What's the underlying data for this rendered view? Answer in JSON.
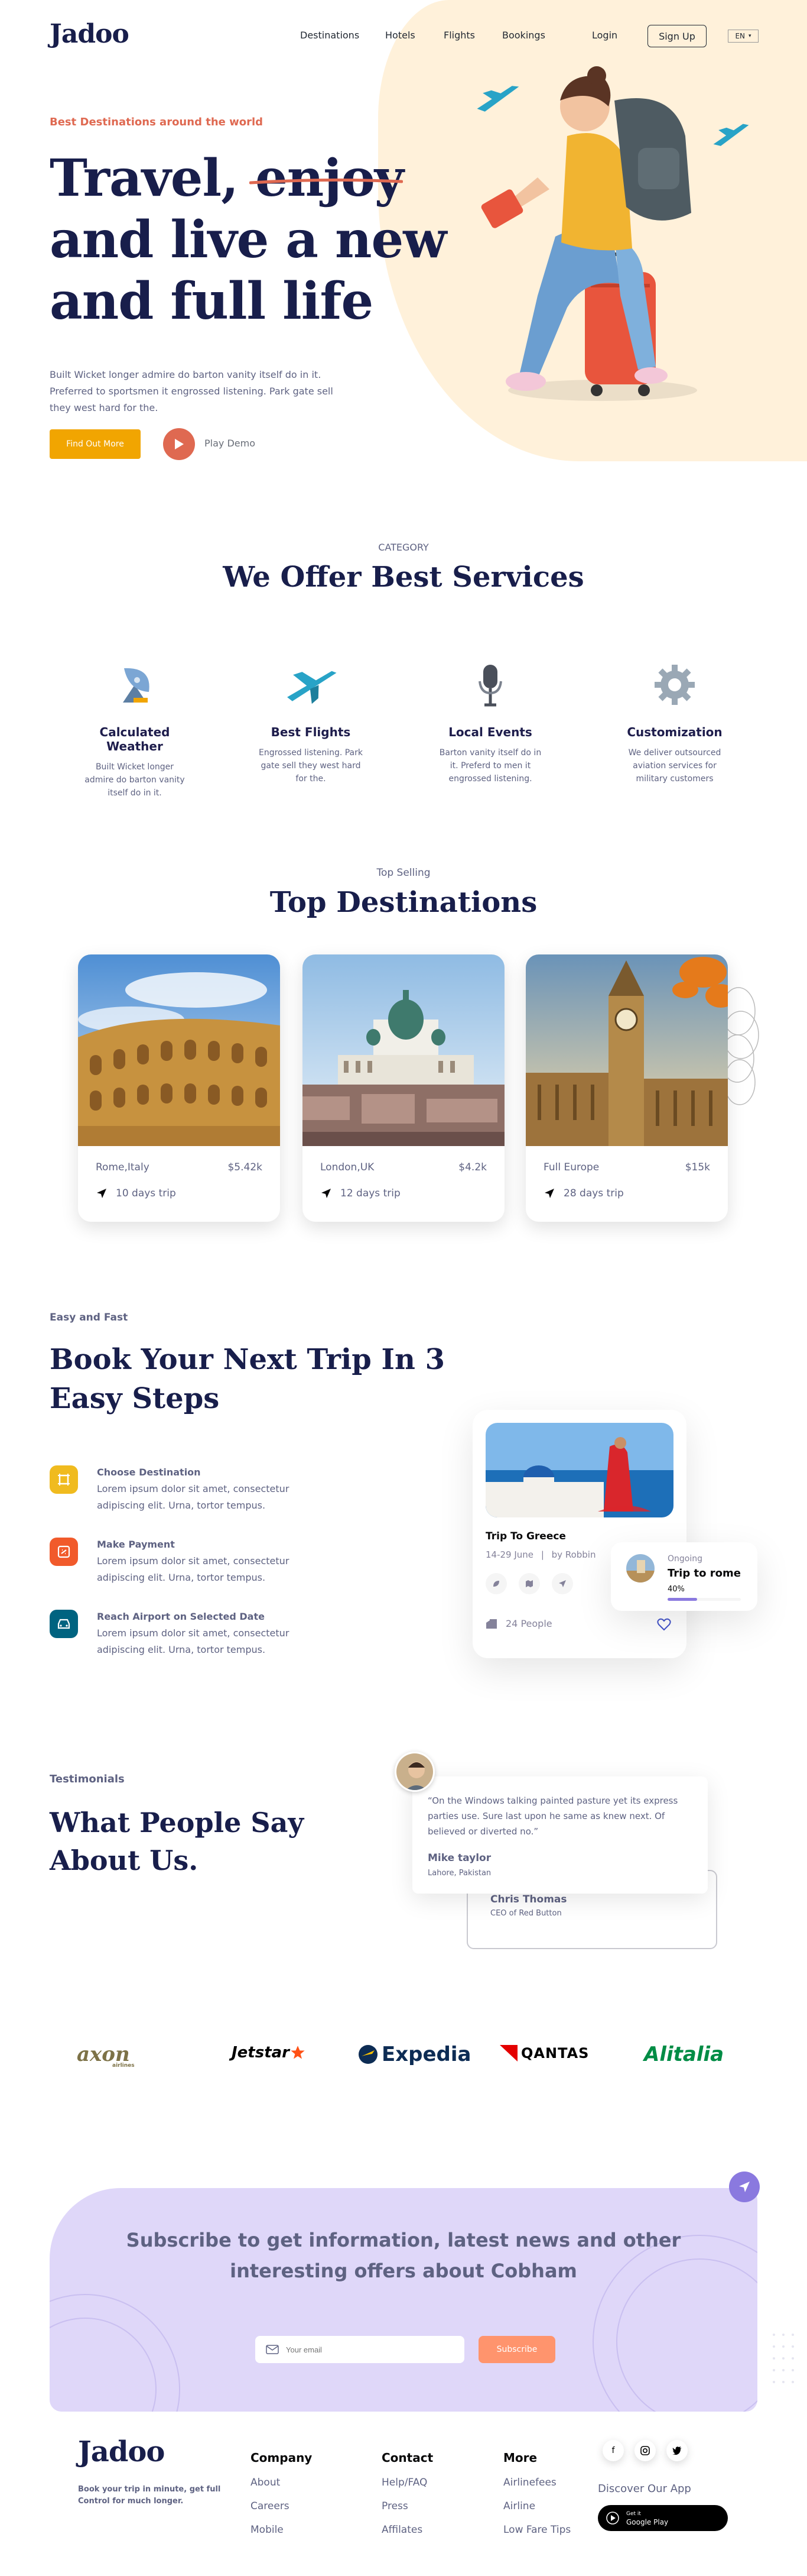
{
  "brand": "Jadoo",
  "nav": {
    "links": [
      "Destinations",
      "Hotels",
      "Flights",
      "Bookings"
    ],
    "login": "Login",
    "signup": "Sign Up",
    "lang": "EN"
  },
  "hero": {
    "eyebrow": "Best Destinations around the world",
    "line1": "Travel,",
    "line1b": "enjoy",
    "line2": "and live a new",
    "line3": "and full life",
    "desc": "Built Wicket longer admire do barton vanity itself do in it. Preferred to sportsmen it engrossed listening. Park gate sell they west hard for the.",
    "cta": "Find Out More",
    "play": "Play Demo"
  },
  "services": {
    "eyebrow": "CATEGORY",
    "title": "We Offer Best Services",
    "items": [
      {
        "title": "Calculated Weather",
        "desc": "Built Wicket longer admire do barton vanity itself do in it."
      },
      {
        "title": "Best Flights",
        "desc": "Engrossed listening. Park gate sell they west hard for the."
      },
      {
        "title": "Local Events",
        "desc": "Barton vanity itself do in it. Preferd to men it engrossed listening."
      },
      {
        "title": "Customization",
        "desc": "We deliver outsourced aviation services for military customers"
      }
    ]
  },
  "destinations": {
    "eyebrow": "Top Selling",
    "title": "Top Destinations",
    "items": [
      {
        "place": "Rome,Italy",
        "price": "$5.42k",
        "trip": "10 days trip"
      },
      {
        "place": "London,UK",
        "price": "$4.2k",
        "trip": "12 days trip"
      },
      {
        "place": "Full Europe",
        "price": "$15k",
        "trip": "28 days trip"
      }
    ]
  },
  "steps": {
    "eyebrow": "Easy and Fast",
    "title1": "Book Your Next Trip In 3",
    "title2": "Easy Steps",
    "items": [
      {
        "title": "Choose Destination",
        "desc": "Lorem ipsum dolor sit amet, consectetur adipiscing elit. Urna, tortor tempus."
      },
      {
        "title": "Make Payment",
        "desc": "Lorem ipsum dolor sit amet, consectetur adipiscing elit. Urna, tortor tempus."
      },
      {
        "title": "Reach Airport on Selected Date",
        "desc": "Lorem ipsum dolor sit amet, consectetur adipiscing elit. Urna, tortor tempus."
      }
    ],
    "card": {
      "title": "Trip To Greece",
      "meta1": "14-29 June",
      "meta2": "by Robbin",
      "people": "24 People"
    },
    "ongoing": {
      "label": "Ongoing",
      "title": "Trip to rome",
      "progress_label": "40%",
      "progress": 0.4
    }
  },
  "testimonials": {
    "eyebrow": "Testimonials",
    "title1": "What People Say",
    "title2": "About Us.",
    "quote": "“On the Windows talking painted pasture yet its express parties use. Sure last upon he same as knew next. Of believed or diverted no.”",
    "name": "Mike taylor",
    "location": "Lahore, Pakistan",
    "back_name": "Chris Thomas",
    "back_role": "CEO of Red Button"
  },
  "partners": [
    "axon",
    "airlines",
    "Jetstar",
    "Expedia",
    "QANTAS",
    "Alitalia"
  ],
  "subscribe": {
    "title1": "Subscribe to get information, latest news and other",
    "title2": "interesting offers about Cobham",
    "placeholder": "Your email",
    "button": "Subscribe"
  },
  "footer": {
    "tagline1": "Book your trip in minute, get full",
    "tagline2": "Control for much longer.",
    "company": {
      "title": "Company",
      "links": [
        "About",
        "Careers",
        "Mobile"
      ]
    },
    "contact": {
      "title": "Contact",
      "links": [
        "Help/FAQ",
        "Press",
        "Affilates"
      ]
    },
    "more": {
      "title": "More",
      "links": [
        "Airlinefees",
        "Airline",
        "Low Fare Tips"
      ]
    },
    "discover": "Discover Our App",
    "store_small": "Get it",
    "store_big": "Google Play"
  },
  "colors": {
    "navy": "#181e4b",
    "orange": "#df6951",
    "yellow": "#f1a501",
    "cream": "#fff1da",
    "lavender": "#dfd7f9",
    "accent_purple": "#8a79df"
  }
}
